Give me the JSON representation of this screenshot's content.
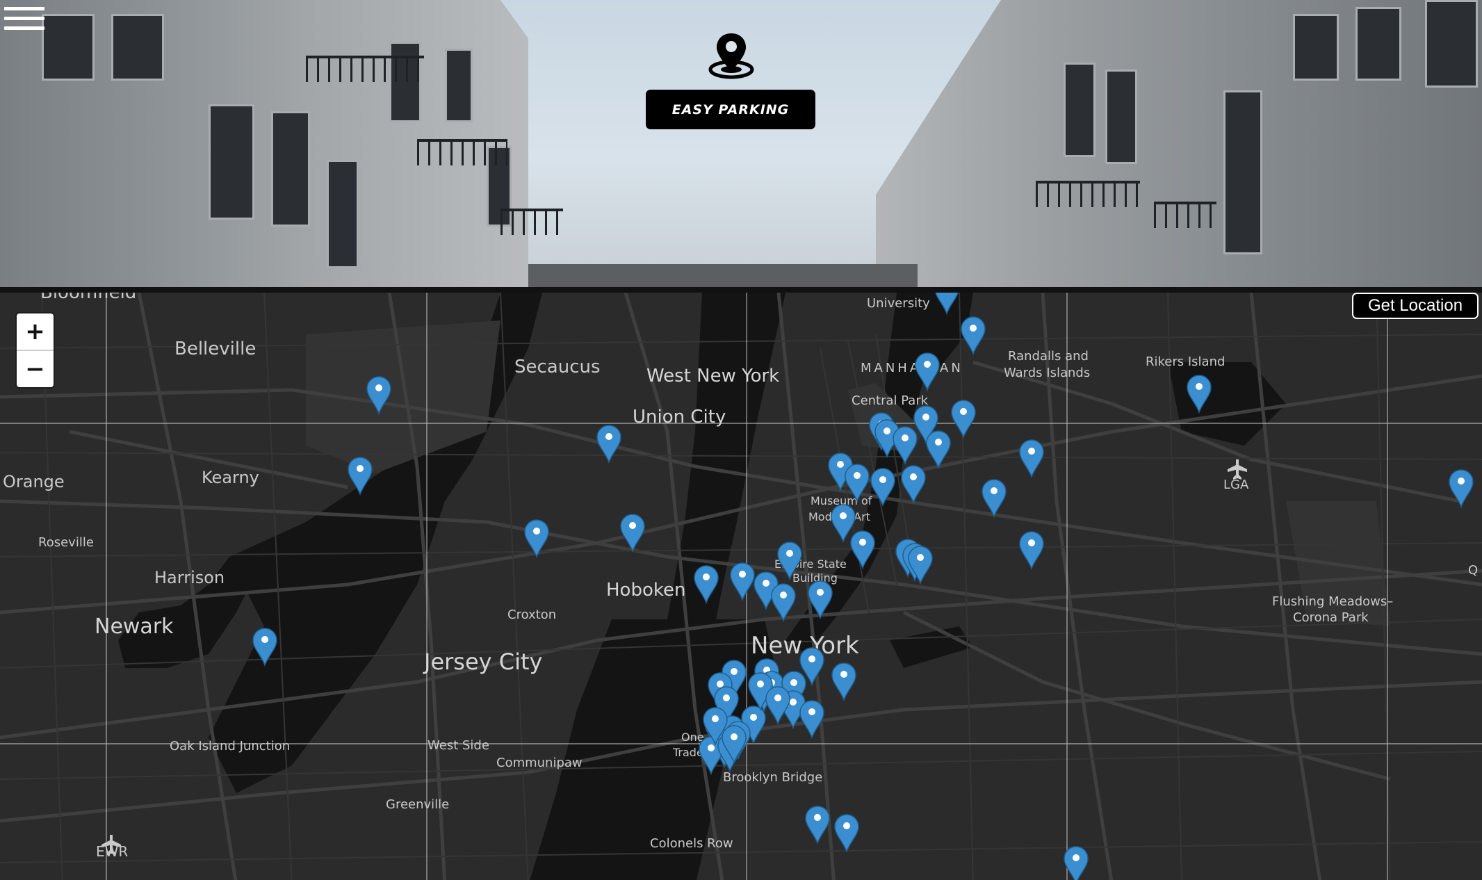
{
  "header": {
    "menu_icon": "hamburger-menu-icon",
    "logo_icon": "location-pin-icon",
    "brand_label": "Easy Parking"
  },
  "map": {
    "zoom_in_label": "+",
    "zoom_out_label": "−",
    "get_location_label": "Get Location",
    "marker_color": "#3b8fd0",
    "background_color": "#2b2b2b",
    "road_color": "#3c3c3c",
    "water_color": "#141414",
    "places": [
      {
        "id": "bloomfield",
        "text": "Bloomfield"
      },
      {
        "id": "belleville",
        "text": "Belleville"
      },
      {
        "id": "secaucus",
        "text": "Secaucus"
      },
      {
        "id": "west-new-york",
        "text": "West New York"
      },
      {
        "id": "union-city",
        "text": "Union City"
      },
      {
        "id": "university",
        "text": "University"
      },
      {
        "id": "manhattan",
        "text": "MANHATTAN"
      },
      {
        "id": "central-park",
        "text": "Central Park"
      },
      {
        "id": "randalls-1",
        "text": "Randalls and"
      },
      {
        "id": "randalls-2",
        "text": "Wards Islands"
      },
      {
        "id": "rikers",
        "text": "Rikers Island"
      },
      {
        "id": "orange",
        "text": "Orange"
      },
      {
        "id": "kearny",
        "text": "Kearny"
      },
      {
        "id": "lga",
        "text": "LGA"
      },
      {
        "id": "moma-1",
        "text": "Museum of"
      },
      {
        "id": "moma-2",
        "text": "Modern Art"
      },
      {
        "id": "roseville",
        "text": "Roseville"
      },
      {
        "id": "harrison",
        "text": "Harrison"
      },
      {
        "id": "esb-1",
        "text": "Empire State"
      },
      {
        "id": "esb-2",
        "text": "Building"
      },
      {
        "id": "hoboken",
        "text": "Hoboken"
      },
      {
        "id": "croxton",
        "text": "Croxton"
      },
      {
        "id": "flushing-1",
        "text": "Flushing Meadows–"
      },
      {
        "id": "flushing-2",
        "text": "Corona Park"
      },
      {
        "id": "newark",
        "text": "Newark"
      },
      {
        "id": "new-york",
        "text": "New York"
      },
      {
        "id": "jersey-city",
        "text": "Jersey City"
      },
      {
        "id": "oak-island",
        "text": "Oak Island Junction"
      },
      {
        "id": "west-side",
        "text": "West Side"
      },
      {
        "id": "communipaw",
        "text": "Communipaw"
      },
      {
        "id": "one-wtc-1",
        "text": "One"
      },
      {
        "id": "one-wtc-2",
        "text": "Trade"
      },
      {
        "id": "brooklyn-bridge",
        "text": "Brooklyn Bridge"
      },
      {
        "id": "greenville",
        "text": "Greenville"
      },
      {
        "id": "ewr",
        "text": "EWR"
      },
      {
        "id": "colonels-row",
        "text": "Colonels Row"
      },
      {
        "id": "edge-q",
        "text": "Q"
      }
    ],
    "marker_count": 60
  }
}
